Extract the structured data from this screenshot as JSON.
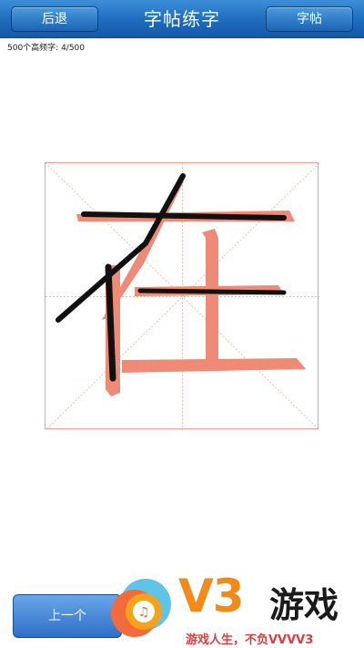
{
  "header": {
    "title": "字帖练字",
    "back_label": "后退",
    "right_label": "字帖"
  },
  "progress": {
    "text": "500个高频字: 4/500"
  },
  "practice": {
    "character": "在",
    "guide_color": "#ef8a76",
    "stroke_color": "#111111"
  },
  "footer": {
    "prev_label": "上一个"
  },
  "watermark": {
    "brand": "V3",
    "game_text": "游戏",
    "slogan": "游戏人生，不负VVVV3"
  }
}
